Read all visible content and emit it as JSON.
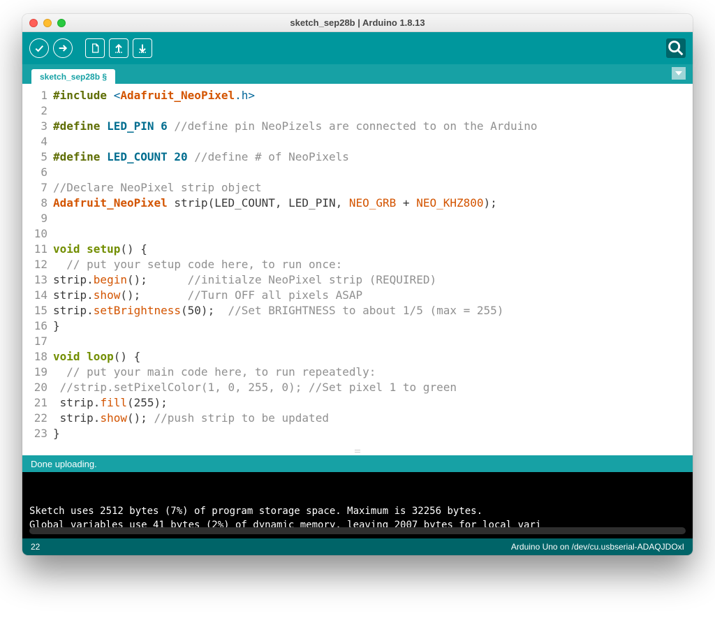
{
  "window_title": "sketch_sep28b | Arduino 1.8.13",
  "tab_name": "sketch_sep28b §",
  "status_message": "Done uploading.",
  "console_lines": [
    "Sketch uses 2512 bytes (7%) of program storage space. Maximum is 32256 bytes.",
    "Global variables use 41 bytes (2%) of dynamic memory, leaving 2007 bytes for local vari"
  ],
  "footer_left": "22",
  "footer_right": "Arduino Uno on /dev/cu.usbserial-ADAQJDOxI",
  "code": [
    {
      "n": 1,
      "tokens": [
        [
          "#include ",
          "c-pre"
        ],
        [
          "<",
          "c-str"
        ],
        [
          "Adafruit_NeoPixel",
          "c-type"
        ],
        [
          ".h>",
          "c-str"
        ]
      ]
    },
    {
      "n": 2,
      "tokens": [
        [
          "",
          ""
        ]
      ]
    },
    {
      "n": 3,
      "tokens": [
        [
          "#define ",
          "c-pre"
        ],
        [
          "LED_PIN 6 ",
          "c-const"
        ],
        [
          "//define pin NeoPizels are connected to on the Arduino",
          "c-comment"
        ]
      ]
    },
    {
      "n": 4,
      "tokens": [
        [
          "",
          ""
        ]
      ]
    },
    {
      "n": 5,
      "tokens": [
        [
          "#define ",
          "c-pre"
        ],
        [
          "LED_COUNT 20 ",
          "c-const"
        ],
        [
          "//define # of NeoPixels",
          "c-comment"
        ]
      ]
    },
    {
      "n": 6,
      "tokens": [
        [
          "",
          ""
        ]
      ]
    },
    {
      "n": 7,
      "tokens": [
        [
          "//Declare NeoPixel strip object",
          "c-comment"
        ]
      ]
    },
    {
      "n": 8,
      "tokens": [
        [
          "Adafruit_NeoPixel",
          "c-type"
        ],
        [
          " strip(LED_COUNT, LED_PIN, ",
          ""
        ],
        [
          "NEO_GRB",
          "c-fn"
        ],
        [
          " + ",
          ""
        ],
        [
          "NEO_KHZ800",
          "c-fn"
        ],
        [
          ");",
          ""
        ]
      ]
    },
    {
      "n": 9,
      "tokens": [
        [
          "",
          ""
        ]
      ]
    },
    {
      "n": 10,
      "tokens": [
        [
          "",
          ""
        ]
      ]
    },
    {
      "n": 11,
      "tokens": [
        [
          "void ",
          "c-kw"
        ],
        [
          "setup",
          "c-kw"
        ],
        [
          "() {",
          ""
        ]
      ]
    },
    {
      "n": 12,
      "tokens": [
        [
          "  // put your setup code here, to run once:",
          "c-comment"
        ]
      ]
    },
    {
      "n": 13,
      "tokens": [
        [
          "strip.",
          ""
        ],
        [
          "begin",
          "c-fn"
        ],
        [
          "();      ",
          ""
        ],
        [
          "//initialze NeoPixel strip (REQUIRED)",
          "c-comment"
        ]
      ]
    },
    {
      "n": 14,
      "tokens": [
        [
          "strip.",
          ""
        ],
        [
          "show",
          "c-fn"
        ],
        [
          "();       ",
          ""
        ],
        [
          "//Turn OFF all pixels ASAP",
          "c-comment"
        ]
      ]
    },
    {
      "n": 15,
      "tokens": [
        [
          "strip.",
          ""
        ],
        [
          "setBrightness",
          "c-fn"
        ],
        [
          "(50);  ",
          ""
        ],
        [
          "//Set BRIGHTNESS to about 1/5 (max = 255)",
          "c-comment"
        ]
      ]
    },
    {
      "n": 16,
      "tokens": [
        [
          "}",
          ""
        ]
      ]
    },
    {
      "n": 17,
      "tokens": [
        [
          "",
          ""
        ]
      ]
    },
    {
      "n": 18,
      "tokens": [
        [
          "void ",
          "c-kw"
        ],
        [
          "loop",
          "c-kw"
        ],
        [
          "() {",
          ""
        ]
      ]
    },
    {
      "n": 19,
      "tokens": [
        [
          "  // put your main code here, to run repeatedly:",
          "c-comment"
        ]
      ]
    },
    {
      "n": 20,
      "tokens": [
        [
          " //strip.setPixelColor(1, 0, 255, 0); //Set pixel 1 to green",
          "c-comment"
        ]
      ]
    },
    {
      "n": 21,
      "tokens": [
        [
          " strip.",
          ""
        ],
        [
          "fill",
          "c-fn"
        ],
        [
          "(255);",
          ""
        ]
      ]
    },
    {
      "n": 22,
      "tokens": [
        [
          " strip.",
          ""
        ],
        [
          "show",
          "c-fn"
        ],
        [
          "(); ",
          ""
        ],
        [
          "//push strip to be updated",
          "c-comment"
        ]
      ]
    },
    {
      "n": 23,
      "tokens": [
        [
          "}",
          ""
        ]
      ]
    }
  ]
}
